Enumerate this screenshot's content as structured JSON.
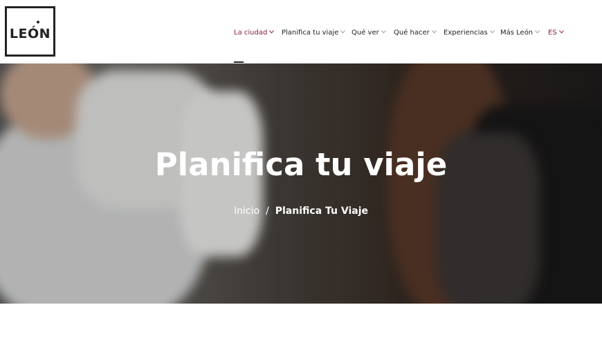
{
  "logo": {
    "text": "LEÓN"
  },
  "nav": {
    "items": [
      {
        "label": "La ciudad",
        "active": true
      },
      {
        "label": "Planifica tu viaje"
      },
      {
        "label": "Qué ver"
      },
      {
        "label": "Qué hacer"
      },
      {
        "label": "Experiencias"
      },
      {
        "label": "Más León"
      }
    ],
    "language": "ES"
  },
  "hero": {
    "title": "Planifica tu viaje",
    "breadcrumb": {
      "home": "Inicio",
      "separator": "/",
      "current": "Planifica Tu Viaje"
    }
  },
  "colors": {
    "accent": "#8a1a4a",
    "text": "#222222"
  }
}
